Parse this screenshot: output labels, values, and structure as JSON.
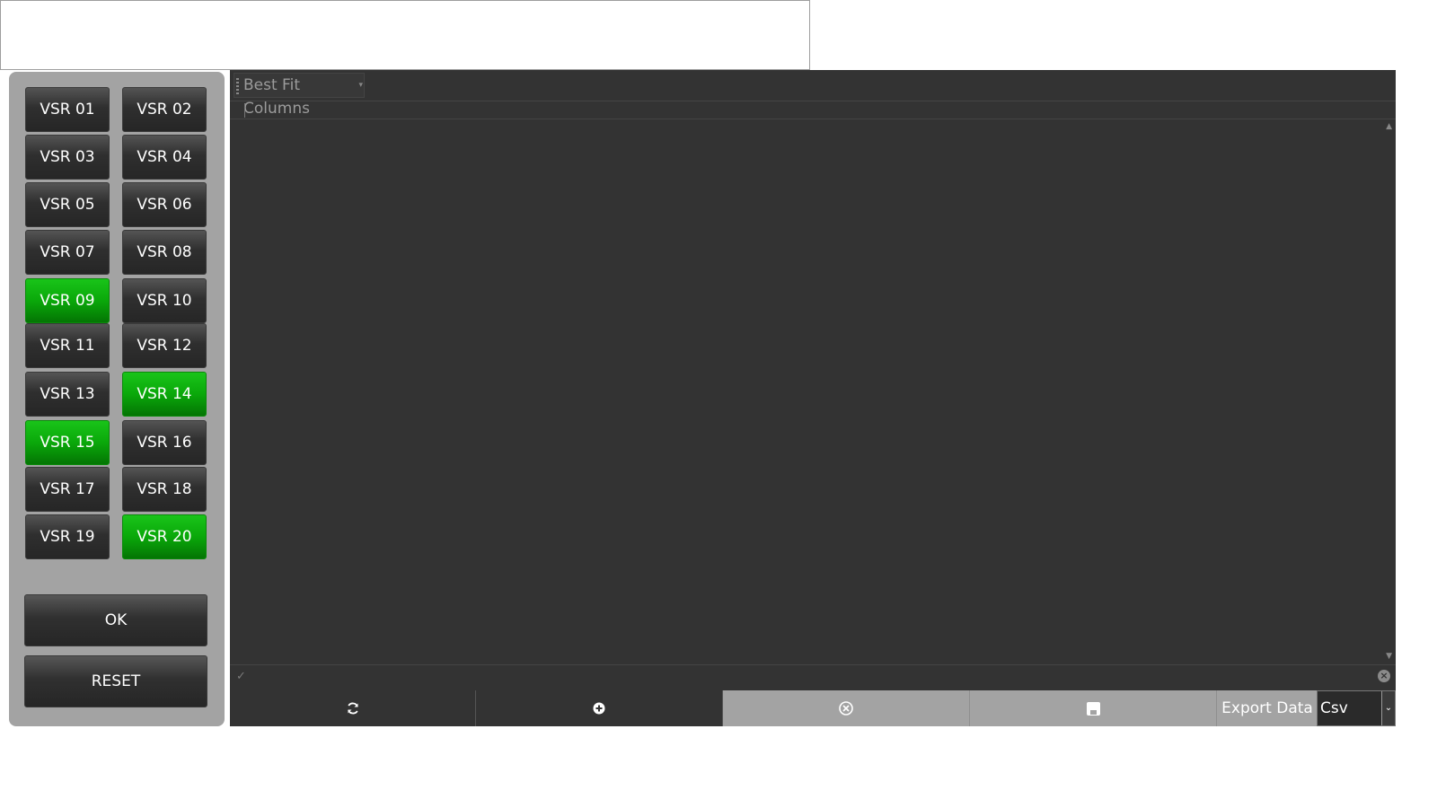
{
  "top_box": {
    "faint_text": ""
  },
  "vsr_buttons": [
    {
      "label": "VSR 01",
      "active": false
    },
    {
      "label": "VSR 02",
      "active": false
    },
    {
      "label": "VSR 03",
      "active": false
    },
    {
      "label": "VSR 04",
      "active": false
    },
    {
      "label": "VSR 05",
      "active": false
    },
    {
      "label": "VSR 06",
      "active": false
    },
    {
      "label": "VSR 07",
      "active": false
    },
    {
      "label": "VSR 08",
      "active": false
    },
    {
      "label": "VSR 09",
      "active": true
    },
    {
      "label": "VSR 10",
      "active": false
    },
    {
      "label": "VSR 11",
      "active": false
    },
    {
      "label": "VSR 12",
      "active": false
    },
    {
      "label": "VSR 13",
      "active": false
    },
    {
      "label": "VSR 14",
      "active": true
    },
    {
      "label": "VSR 15",
      "active": true
    },
    {
      "label": "VSR 16",
      "active": false
    },
    {
      "label": "VSR 17",
      "active": false
    },
    {
      "label": "VSR 18",
      "active": false
    },
    {
      "label": "VSR 19",
      "active": false
    },
    {
      "label": "VSR 20",
      "active": true
    }
  ],
  "actions": {
    "ok": "OK",
    "reset": "RESET"
  },
  "grid": {
    "best_fit_columns": "Best Fit Columns"
  },
  "bottom_bar": {
    "refresh_icon": "refresh-icon",
    "add_icon": "add-circle-icon",
    "delete_icon": "close-circle-icon",
    "save_icon": "save-icon",
    "export_label": "Export Data",
    "export_format": "Csv"
  },
  "colors": {
    "active": "#0aa80a",
    "panel": "#a3a3a3",
    "grid_bg": "#333333"
  }
}
